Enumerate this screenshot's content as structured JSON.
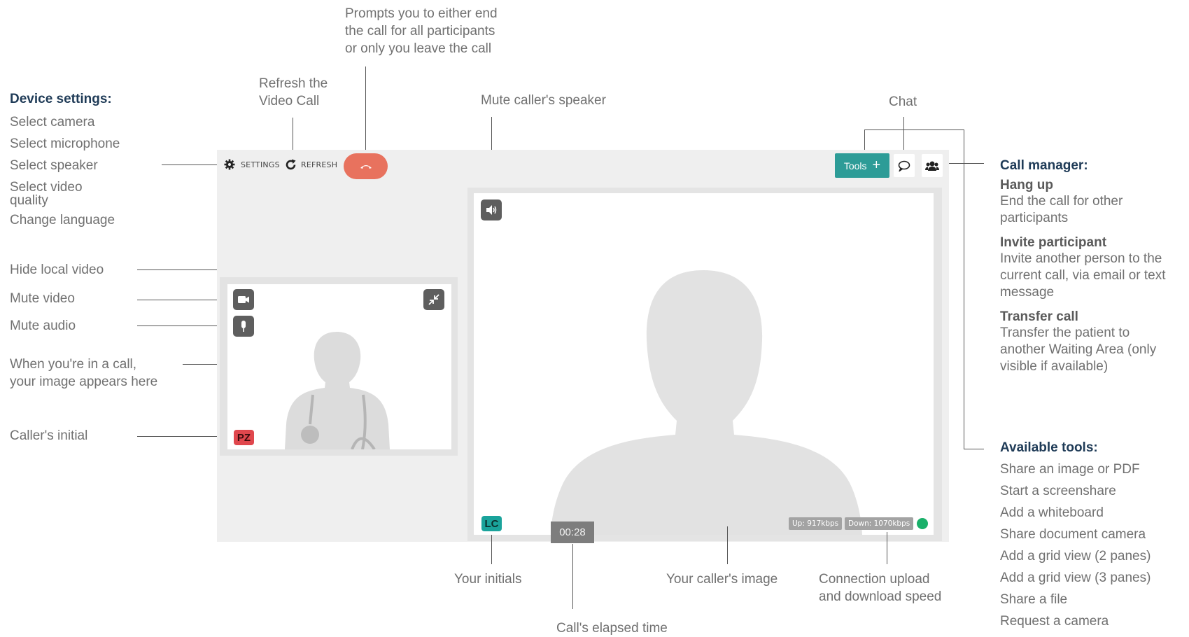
{
  "top_note": {
    "lines": [
      "Prompts you to either end",
      "the call for all participants",
      "or only you leave the call"
    ]
  },
  "refresh_note": {
    "lines": [
      "Refresh the",
      "Video Call"
    ]
  },
  "mute_speaker_note": "Mute caller's speaker",
  "chat_note": "Chat",
  "device_settings": {
    "heading": "Device settings:",
    "items": [
      "Select camera",
      "Select microphone",
      "Select speaker",
      "Select video",
      "quality",
      "Change language"
    ]
  },
  "left_notes": {
    "hide_local_video": "Hide local video",
    "mute_video": "Mute video",
    "mute_audio": "Mute audio",
    "your_image": [
      "When you're in a call,",
      "your image appears here"
    ],
    "callers_initial": "Caller's initial"
  },
  "call_manager": {
    "heading": "Call manager:",
    "hang_up": {
      "title": "Hang up",
      "lines": [
        "End the call for other",
        "participants"
      ]
    },
    "invite": {
      "title": "Invite participant",
      "lines": [
        "Invite another person to the",
        "current call, via email or text",
        "message"
      ]
    },
    "transfer": {
      "title": "Transfer call",
      "lines": [
        "Transfer the patient to",
        "another Waiting Area (only",
        "visible if available)"
      ]
    }
  },
  "available_tools": {
    "heading": "Available tools:",
    "items": [
      "Share an image or PDF",
      "Start a screenshare",
      "Add a whiteboard",
      "Share document camera",
      "Add a grid view (2 panes)",
      "Add a grid view (3 panes)",
      "Share a file",
      "Request a camera"
    ]
  },
  "bottom_notes": {
    "your_initials": "Your initials",
    "elapsed_time": "Call's elapsed time",
    "callers_image": "Your caller's image",
    "connection": [
      "Connection upload",
      "and download speed"
    ]
  },
  "toolbar": {
    "settings_label": "SETTINGS",
    "refresh_label": "REFRESH",
    "tools_label": "Tools",
    "tools_plus": "+"
  },
  "call": {
    "local_initials": "PZ",
    "remote_initials": "LC",
    "elapsed": "00:28",
    "upload": "Up: 917kbps",
    "download": "Down: 1070kbps"
  },
  "colors": {
    "hangup": "#e8725e",
    "tools": "#2d9c97",
    "local_badge": "#e0474d",
    "remote_badge": "#1aa39b",
    "connection_ok": "#1ab06a"
  }
}
